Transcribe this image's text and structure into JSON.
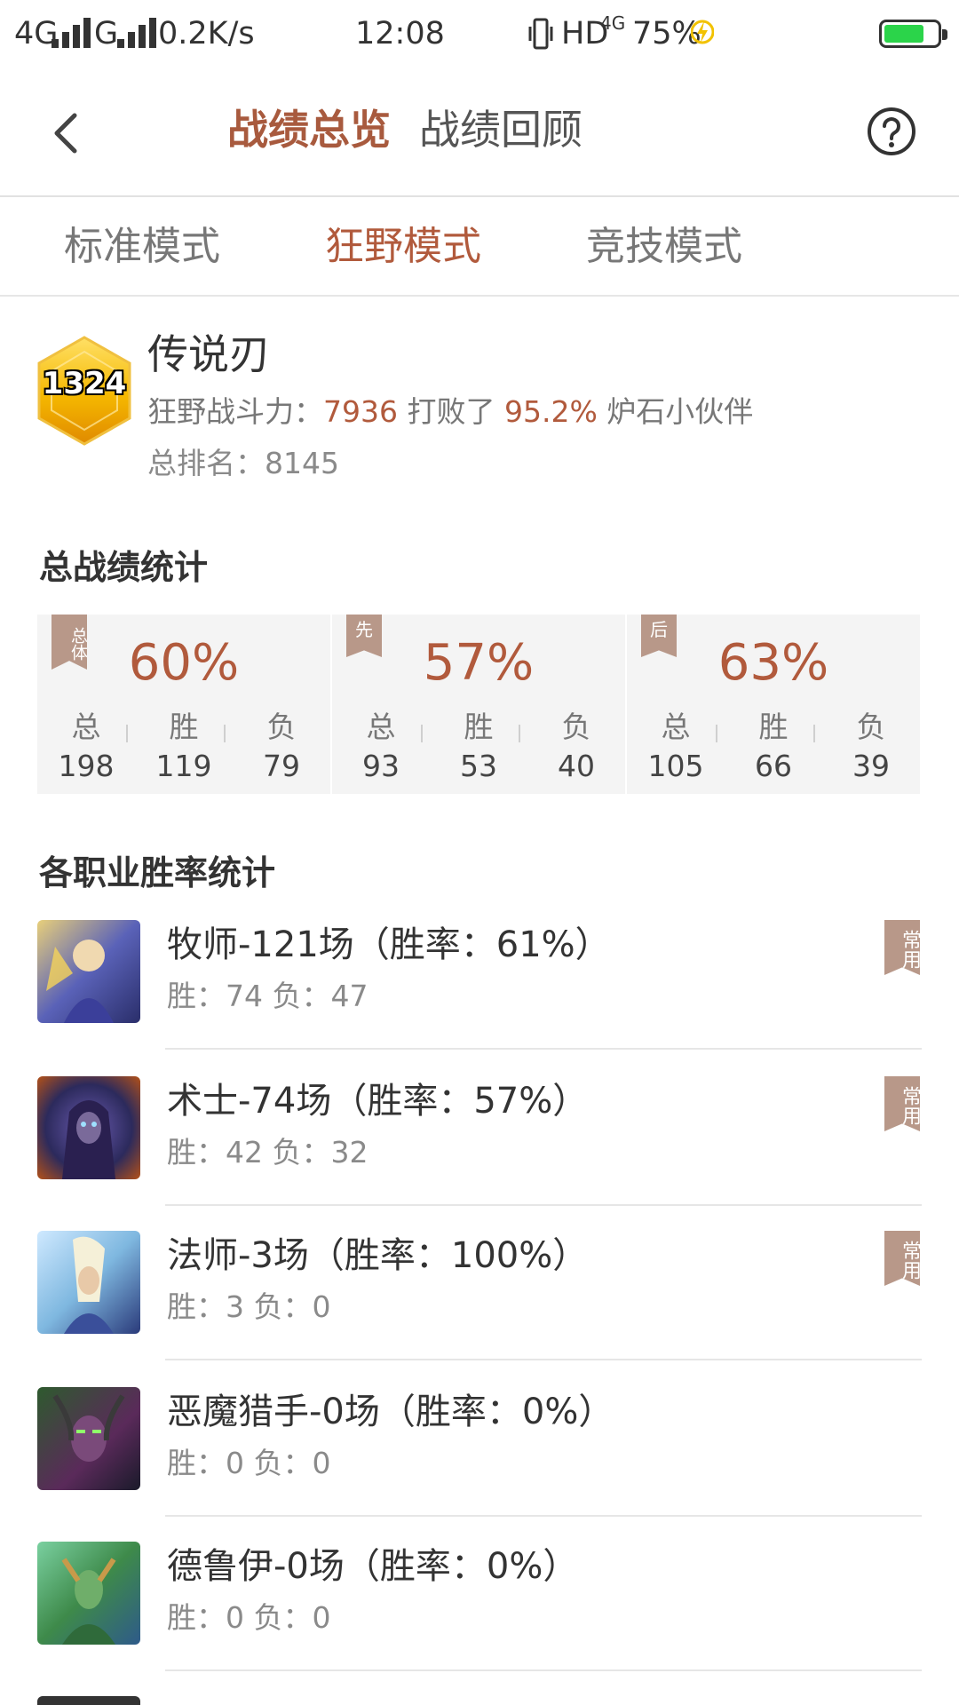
{
  "status_bar": {
    "network1": "4G",
    "network2": "G",
    "speed": "0.2K/s",
    "time": "12:08",
    "hd": "HD",
    "net4g": "4G",
    "battery": "75%",
    "battery_level": 0.75
  },
  "header": {
    "tab_overview": "战绩总览",
    "tab_review": "战绩回顾"
  },
  "modes": {
    "standard": "标准模式",
    "wild": "狂野模式",
    "arena": "竞技模式"
  },
  "profile": {
    "badge_number": "1324",
    "name": "传说刃",
    "power_label": "狂野战斗力：",
    "power_value": "7936",
    "defeated_label": " 打败了 ",
    "defeated_pct": "95.2%",
    "defeated_suffix": " 炉石小伙伴",
    "rank_text": "总排名：8145"
  },
  "stats": {
    "title": "总战绩统计",
    "cards": [
      {
        "ribbon": "总体",
        "pct": "60%",
        "labels": [
          "总",
          "胜",
          "负"
        ],
        "values": [
          "198",
          "119",
          "79"
        ]
      },
      {
        "ribbon": "先",
        "pct": "57%",
        "labels": [
          "总",
          "胜",
          "负"
        ],
        "values": [
          "93",
          "53",
          "40"
        ]
      },
      {
        "ribbon": "后",
        "pct": "63%",
        "labels": [
          "总",
          "胜",
          "负"
        ],
        "values": [
          "105",
          "66",
          "39"
        ]
      }
    ]
  },
  "classes": {
    "title": "各职业胜率统计",
    "tag_label": "常用",
    "items": [
      {
        "title": "牧师-121场（胜率：61%）",
        "sub": "胜：74  负：47",
        "common": true,
        "colors": [
          "#d9b45a",
          "#3a3f8f"
        ]
      },
      {
        "title": "术士-74场（胜率：57%）",
        "sub": "胜：42  负：32",
        "common": true,
        "colors": [
          "#8a3a1a",
          "#2c2a5c"
        ]
      },
      {
        "title": "法师-3场（胜率：100%）",
        "sub": "胜：3  负：0",
        "common": true,
        "colors": [
          "#8fc6e8",
          "#3b4f8a"
        ]
      },
      {
        "title": "恶魔猎手-0场（胜率：0%）",
        "sub": "胜：0  负：0",
        "common": false,
        "colors": [
          "#3a7a3a",
          "#5a2a5a"
        ]
      },
      {
        "title": "德鲁伊-0场（胜率：0%）",
        "sub": "胜：0  负：0",
        "common": false,
        "colors": [
          "#4aa34a",
          "#2e6a8a"
        ]
      }
    ]
  },
  "colors": {
    "accent": "#b15a3c",
    "ribbon": "#b89889",
    "card_bg": "#f4f4f4"
  }
}
